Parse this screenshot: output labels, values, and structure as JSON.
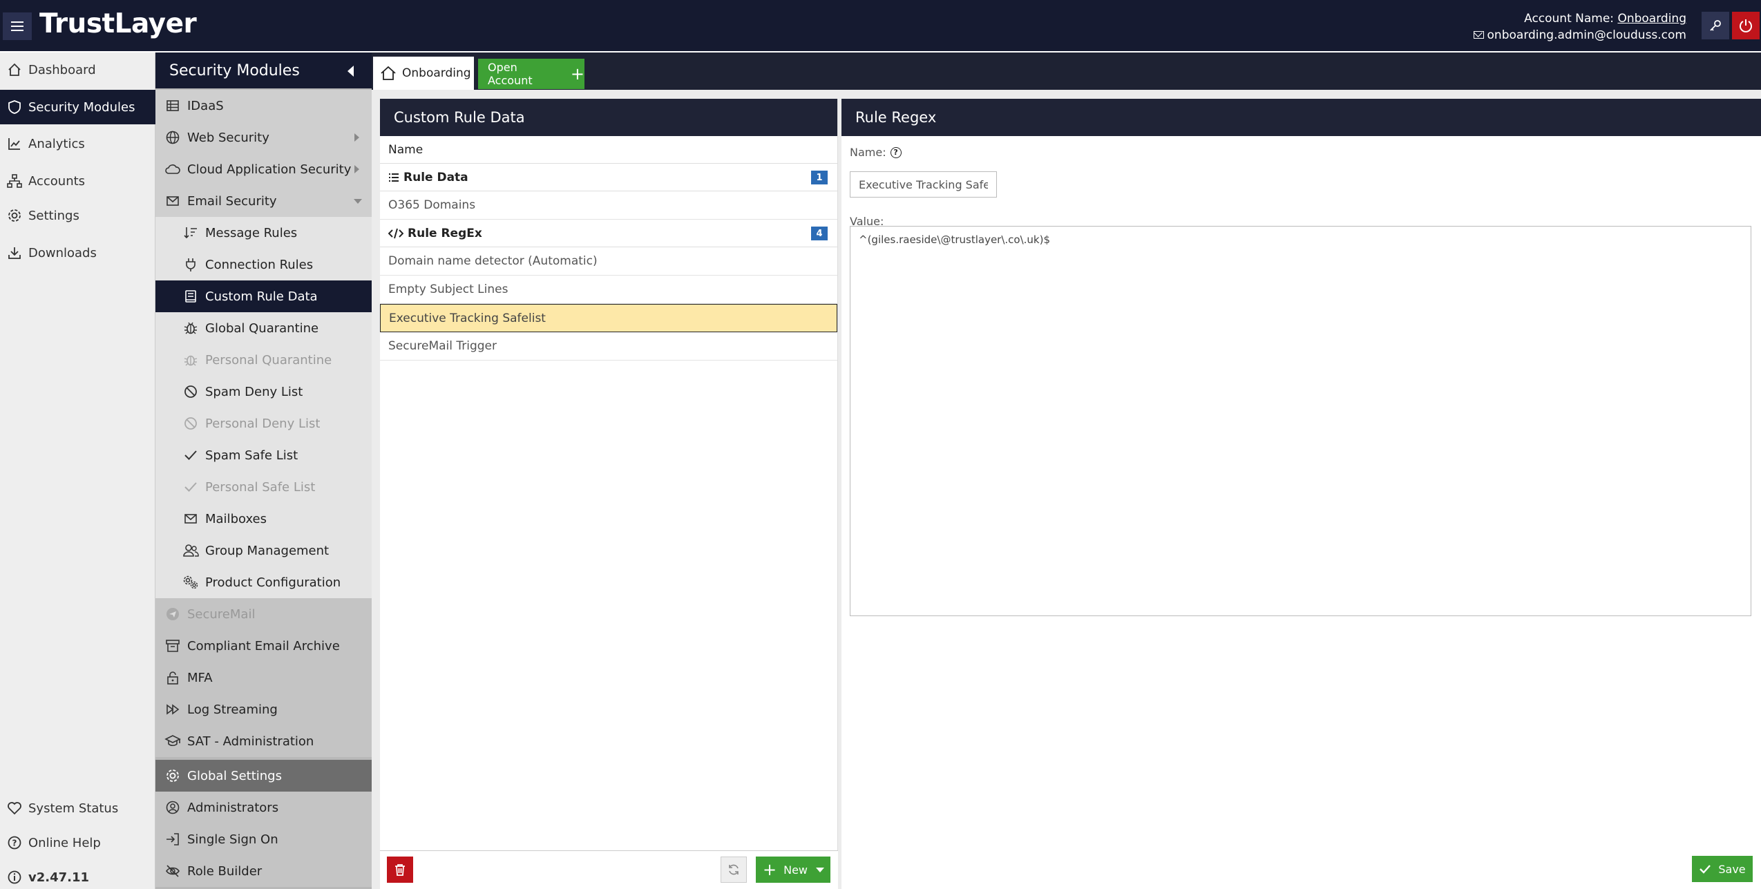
{
  "topbar": {
    "brand": "TrustLayer",
    "account_label": "Account Name:",
    "account_name": "Onboarding",
    "email": "onboarding.admin@clouduss.com"
  },
  "leftnav": {
    "items": [
      {
        "label": "Dashboard",
        "icon": "home-icon"
      },
      {
        "label": "Security Modules",
        "icon": "shield-icon"
      },
      {
        "label": "Analytics",
        "icon": "chart-icon"
      },
      {
        "label": "Accounts",
        "icon": "sitemap-icon"
      },
      {
        "label": "Settings",
        "icon": "gear-icon"
      },
      {
        "label": "Downloads",
        "icon": "download-icon"
      }
    ],
    "bottom": [
      {
        "label": "System Status",
        "icon": "heart-icon"
      },
      {
        "label": "Online Help",
        "icon": "question-icon"
      },
      {
        "label": "v2.47.11",
        "icon": "info-icon"
      }
    ]
  },
  "modules": {
    "title": "Security Modules",
    "items": [
      {
        "label": "IDaaS"
      },
      {
        "label": "Web Security"
      },
      {
        "label": "Cloud Application Security"
      },
      {
        "label": "Email Security"
      },
      {
        "label": "Message Rules"
      },
      {
        "label": "Connection Rules"
      },
      {
        "label": "Custom Rule Data"
      },
      {
        "label": "Global Quarantine"
      },
      {
        "label": "Personal Quarantine"
      },
      {
        "label": "Spam Deny List"
      },
      {
        "label": "Personal Deny List"
      },
      {
        "label": "Spam Safe List"
      },
      {
        "label": "Personal Safe List"
      },
      {
        "label": "Mailboxes"
      },
      {
        "label": "Group Management"
      },
      {
        "label": "Product Configuration"
      },
      {
        "label": "SecureMail"
      },
      {
        "label": "Compliant Email Archive"
      },
      {
        "label": "MFA"
      },
      {
        "label": "Log Streaming"
      },
      {
        "label": "SAT - Administration"
      },
      {
        "label": "Global Settings"
      },
      {
        "label": "Administrators"
      },
      {
        "label": "Single Sign On"
      },
      {
        "label": "Role Builder"
      }
    ]
  },
  "tabs": {
    "home": "Onboarding",
    "open_account": "Open Account"
  },
  "custom_rule_data": {
    "title": "Custom Rule Data",
    "column": "Name",
    "groups": [
      {
        "label": "Rule Data",
        "count": "1",
        "items": [
          "O365 Domains"
        ]
      },
      {
        "label": "Rule RegEx",
        "count": "4",
        "items": [
          "Domain name detector (Automatic)",
          "Empty Subject Lines",
          "Executive Tracking Safelist",
          "SecureMail Trigger"
        ]
      }
    ],
    "new_label": "New"
  },
  "rule_regex": {
    "title": "Rule Regex",
    "name_label": "Name:",
    "name_value": "Executive Tracking Safelis",
    "value_label": "Value:",
    "value_text": "^(giles.raeside\\@trustlayer\\.co\\.uk)$",
    "save_label": "Save"
  }
}
